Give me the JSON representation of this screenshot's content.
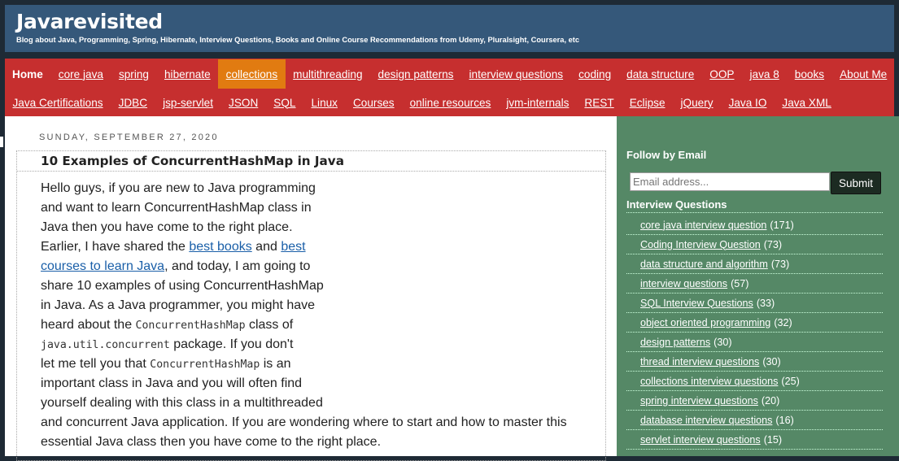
{
  "header": {
    "title": "Javarevisited",
    "description": "Blog about Java, Programming, Spring, Hibernate, Interview Questions, Books and Online Course Recommendations from Udemy, Pluralsight, Coursera, etc"
  },
  "nav": {
    "row1": [
      "Home",
      "core java",
      "spring",
      "hibernate",
      "collections",
      "multithreading",
      "design patterns",
      "interview questions",
      "coding",
      "data structure",
      "OOP",
      "java 8",
      "books",
      "About Me"
    ],
    "row2": [
      "Java Certifications",
      "JDBC",
      "jsp-servlet",
      "JSON",
      "SQL",
      "Linux",
      "Courses",
      "online resources",
      "jvm-internals",
      "REST",
      "Eclipse",
      "jQuery",
      "Java IO",
      "Java XML"
    ],
    "active": "collections",
    "colors": {
      "bar": "#c62f2f",
      "active": "#e17b11"
    }
  },
  "post": {
    "date": "SUNDAY, SEPTEMBER 27, 2020",
    "title": "10 Examples of ConcurrentHashMap in Java",
    "p": {
      "l1": "Hello guys, if you are new to Java programming",
      "l2": "and want to learn ConcurrentHashMap class in",
      "l3": "Java then you have come to the right place.",
      "l4a": "Earlier, I have shared the ",
      "l4link1": "best books",
      "l4b": " and ",
      "l4link2": "best",
      "l5link": "courses to learn Java",
      "l5b": ", and today, I am going to",
      "l6": "share 10 examples of using ConcurrentHashMap",
      "l7": "in Java. As a Java programmer, you might have",
      "l8a": "heard about the ",
      "l8code": "ConcurrentHashMap",
      "l8b": " class of",
      "l9code": "java.util.concurrent",
      "l9b": " package. If you don't",
      "l10a": "let me tell you that ",
      "l10code": "ConcurrentHashMap",
      "l10b": " is an",
      "l11": "important class in Java and you will often find",
      "l12": "yourself dealing with this class in a multithreaded",
      "l13": "and concurrent Java application. If you are wondering where to start and how to master this",
      "l14": "essential Java class then you have come to the right place."
    }
  },
  "sidebar": {
    "follow_heading": "Follow by Email",
    "email_placeholder": "Email address...",
    "submit_label": "Submit",
    "iq_heading": "Interview Questions",
    "items": [
      {
        "label": "core java interview question",
        "count": "(171)"
      },
      {
        "label": "Coding Interview Question",
        "count": "(73)"
      },
      {
        "label": "data structure and algorithm",
        "count": "(73)"
      },
      {
        "label": "interview questions",
        "count": "(57)"
      },
      {
        "label": "SQL Interview Questions",
        "count": "(33)"
      },
      {
        "label": "object oriented programming",
        "count": "(32)"
      },
      {
        "label": "design patterns",
        "count": "(30)"
      },
      {
        "label": "thread interview questions",
        "count": "(30)"
      },
      {
        "label": "collections interview questions",
        "count": "(25)"
      },
      {
        "label": "spring interview questions",
        "count": "(20)"
      },
      {
        "label": "database interview questions",
        "count": "(16)"
      },
      {
        "label": "servlet interview questions",
        "count": "(15)"
      }
    ],
    "colors": {
      "background": "#558866"
    }
  }
}
